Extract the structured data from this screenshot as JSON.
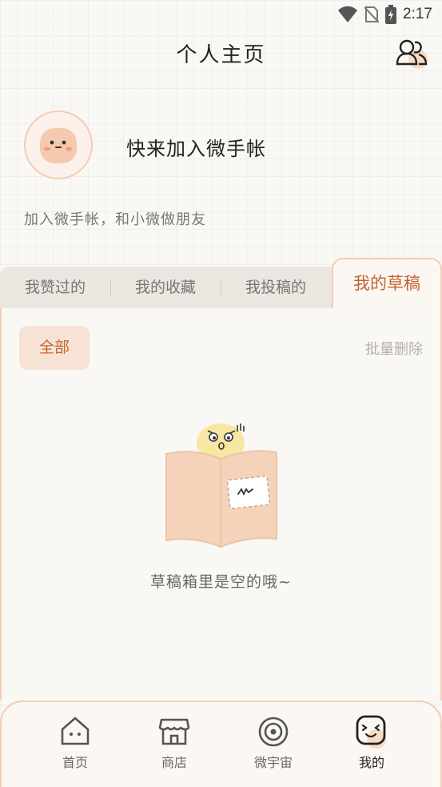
{
  "status_bar": {
    "time": "2:17"
  },
  "header": {
    "title": "个人主页",
    "friends_icon": "friends-icon"
  },
  "profile": {
    "name": "快来加入微手帐",
    "bio": "加入微手帐，和小微做朋友"
  },
  "tabs": [
    {
      "label": "我赞过的",
      "active": false
    },
    {
      "label": "我的收藏",
      "active": false
    },
    {
      "label": "我投稿的",
      "active": false
    },
    {
      "label": "我的草稿",
      "active": true
    }
  ],
  "filter": {
    "chip_label": "全部",
    "batch_delete_label": "批量删除"
  },
  "empty_state": {
    "text": "草稿箱里是空的哦~"
  },
  "bottom_nav": [
    {
      "label": "首页",
      "icon": "home-icon",
      "active": false
    },
    {
      "label": "商店",
      "icon": "shop-icon",
      "active": false
    },
    {
      "label": "微宇宙",
      "icon": "universe-icon",
      "active": false
    },
    {
      "label": "我的",
      "icon": "face-icon",
      "active": true
    }
  ],
  "colors": {
    "accent": "#c4632f",
    "border": "#f2cdb6",
    "chip_bg": "#f7e3d5",
    "tab_bg": "#ebe6df"
  }
}
